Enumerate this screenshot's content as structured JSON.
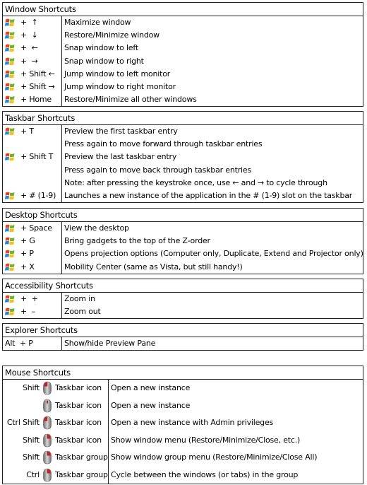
{
  "sections": [
    {
      "title": "Window Shortcuts",
      "rows": [
        {
          "flag": true,
          "key": "+  ↑",
          "desc": "Maximize window"
        },
        {
          "flag": true,
          "key": "+  ↓",
          "desc": "Restore/Minimize window"
        },
        {
          "flag": true,
          "key": "+  ←",
          "desc": "Snap window to left"
        },
        {
          "flag": true,
          "key": "+  →",
          "desc": "Snap window to right"
        },
        {
          "flag": true,
          "key": "+ Shift ←",
          "desc": "Jump window to left monitor"
        },
        {
          "flag": true,
          "key": "+ Shift →",
          "desc": "Jump window to right monitor"
        },
        {
          "flag": true,
          "key": "+ Home",
          "desc": "Restore/Minimize all other windows"
        }
      ]
    },
    {
      "title": "Taskbar Shortcuts",
      "rows": [
        {
          "flag": true,
          "key": "+ T",
          "desc": "Preview the first taskbar entry"
        },
        {
          "flag": false,
          "key": "",
          "desc": "Press again to move forward through taskbar entries"
        },
        {
          "flag": true,
          "key": "+ Shift T",
          "desc": "Preview the last taskbar entry"
        },
        {
          "flag": false,
          "key": "",
          "desc": "Press again to move back through taskbar entries"
        },
        {
          "flag": false,
          "key": "",
          "desc": "Note: after pressing the keystroke once, use ← and → to cycle through"
        },
        {
          "flag": true,
          "key": "+ # (1-9)",
          "desc": "Launches a new instance of the application in the # (1-9) slot on the taskbar"
        }
      ]
    },
    {
      "title": "Desktop Shortcuts",
      "rows": [
        {
          "flag": true,
          "key": "+ Space",
          "desc": "View the desktop"
        },
        {
          "flag": true,
          "key": "+ G",
          "desc": "Bring gadgets to the top of the Z-order"
        },
        {
          "flag": true,
          "key": "+ P",
          "desc": "Opens projection options (Computer only, Duplicate, Extend and Projector only)"
        },
        {
          "flag": true,
          "key": "+ X",
          "desc": "Mobility Center (same as Vista, but still handy!)"
        }
      ]
    },
    {
      "title": "Accessibility Shortcuts",
      "rows": [
        {
          "flag": true,
          "key": "+  +",
          "desc": "Zoom in"
        },
        {
          "flag": true,
          "key": "+  –",
          "desc": "Zoom out"
        }
      ]
    },
    {
      "title": "Explorer Shortcuts",
      "rows": [
        {
          "flag": false,
          "key": "Alt  + P",
          "desc": "Show/hide Preview Pane"
        }
      ]
    }
  ],
  "mouse": {
    "title": "Mouse Shortcuts",
    "rows": [
      {
        "mod": "Shift",
        "button": "left",
        "target": "Taskbar icon",
        "desc": "Open a new instance"
      },
      {
        "mod": "",
        "button": "middle",
        "target": "Taskbar icon",
        "desc": "Open a new instance"
      },
      {
        "mod": "Ctrl Shift",
        "button": "left",
        "target": "Taskbar icon",
        "desc": "Open a new instance with Admin privileges"
      },
      {
        "mod": "Shift",
        "button": "right",
        "target": "Taskbar icon",
        "desc": "Show window menu (Restore/Minimize/Close, etc.)"
      },
      {
        "mod": "Shift",
        "button": "right",
        "target": "Taskbar group",
        "desc": "Show window group menu (Restore/Minimize/Close All)"
      },
      {
        "mod": "Ctrl",
        "button": "right",
        "target": "Taskbar group",
        "desc": "Cycle between the windows (or tabs) in the group"
      }
    ]
  },
  "icons": {
    "flag": "windows-logo-icon",
    "mouse": "mouse-icon"
  },
  "colors": {
    "flag_red": "#e8451e",
    "flag_green": "#6bb42c",
    "flag_blue": "#1e88d8",
    "flag_yellow": "#f6c21a",
    "mouse_button": "#d61a1a"
  }
}
